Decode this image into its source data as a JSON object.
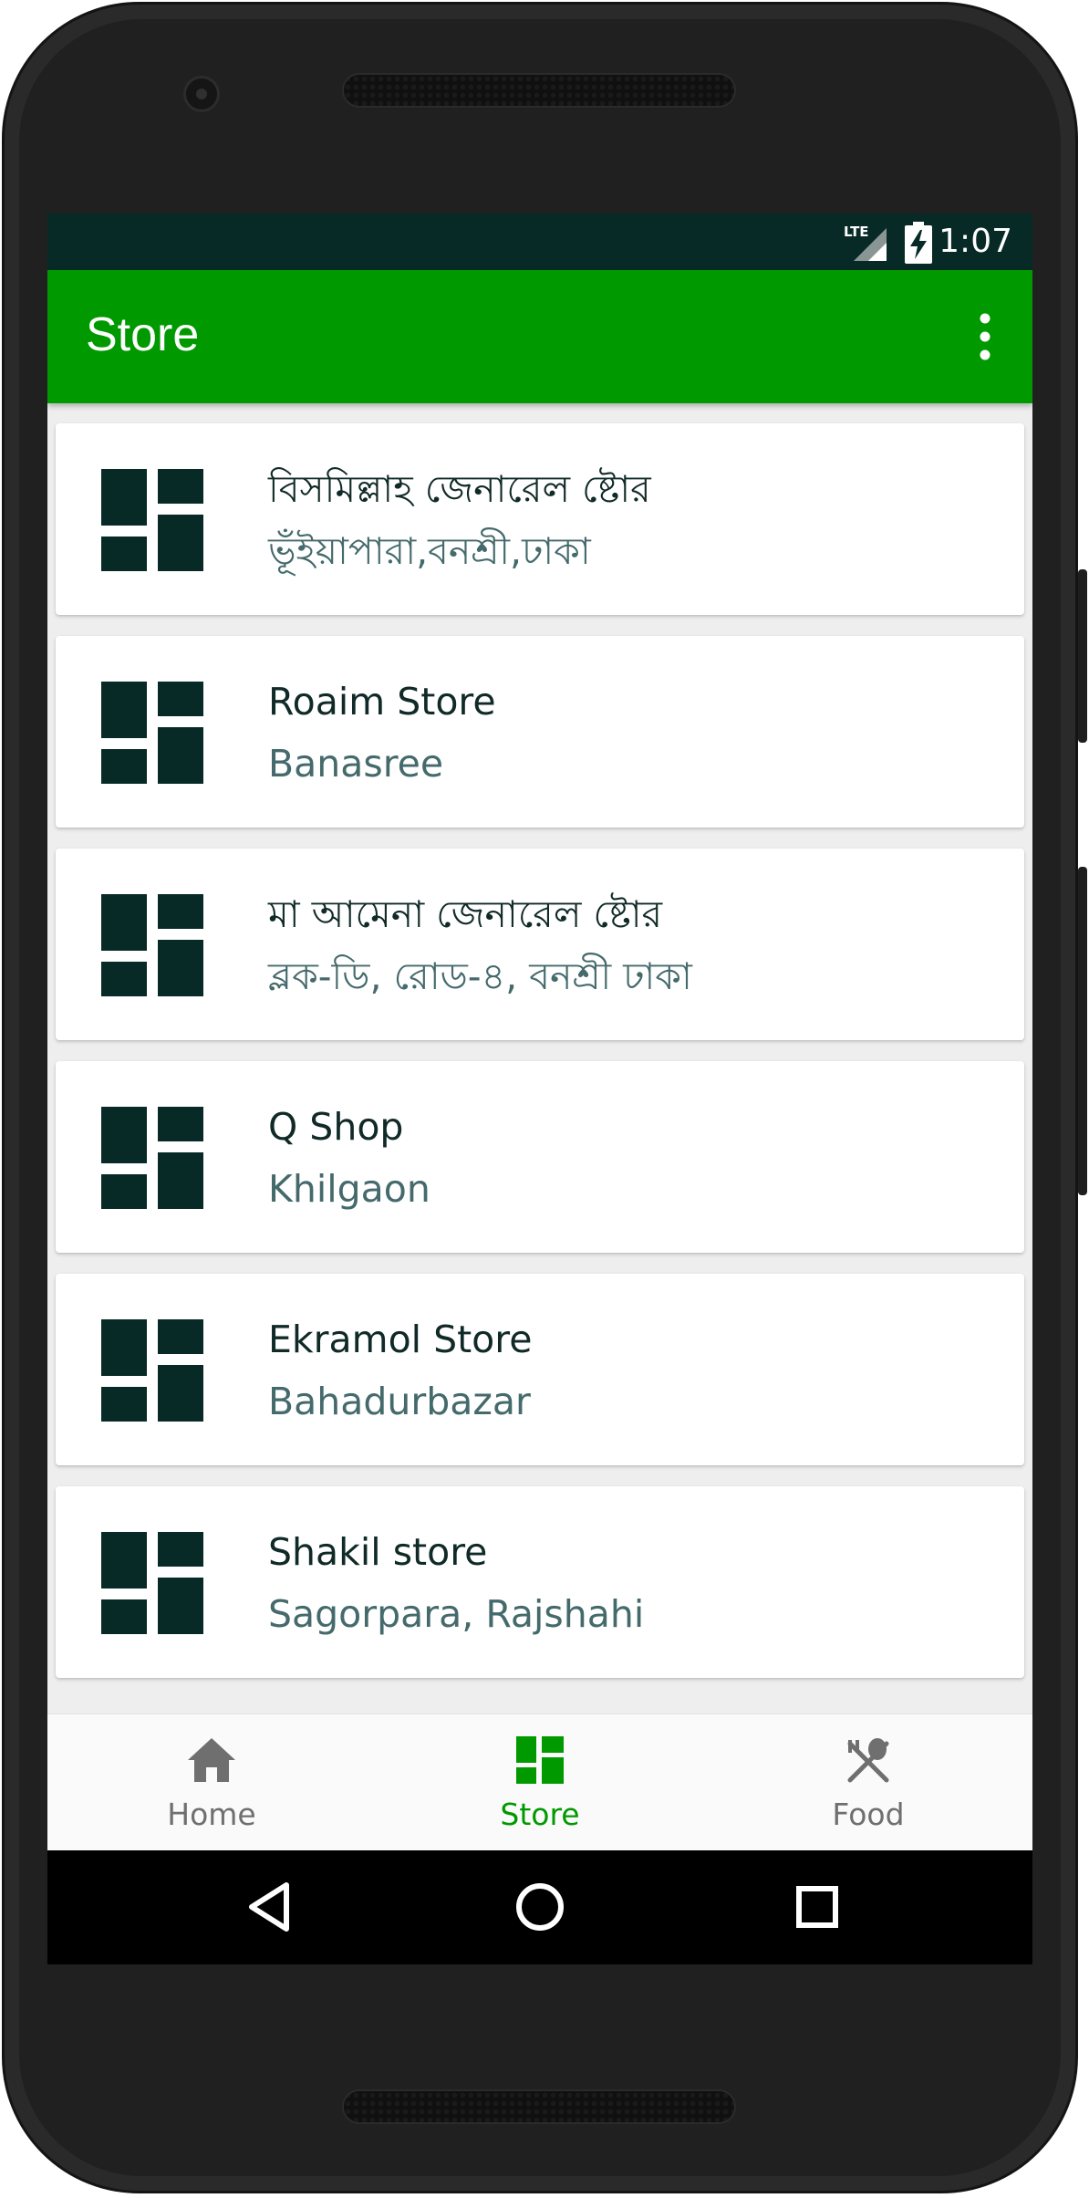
{
  "colors": {
    "status_bar": "#072a27",
    "app_bar": "#009a00",
    "card_icon": "#072a27",
    "title_text": "#102a27",
    "subtitle_text": "#456a6c",
    "nav_active": "#009a00",
    "nav_inactive": "#6f6f6f"
  },
  "status_bar": {
    "network_icon": "lte-signal-icon",
    "battery_icon": "battery-charging-icon",
    "time": "1:07"
  },
  "app_bar": {
    "title": "Store",
    "menu_icon": "more-vert-icon"
  },
  "stores": [
    {
      "name": "বিসমিল্লাহ জেনারেল ষ্টোর",
      "location": "ভূঁইয়াপারা,বনশ্রী,ঢাকা",
      "icon": "dashboard-icon"
    },
    {
      "name": "Roaim Store",
      "location": "Banasree",
      "icon": "dashboard-icon"
    },
    {
      "name": "মা আমেনা জেনারেল ষ্টোর",
      "location": "ব্লক-ডি, রোড-৪, বনশ্রী ঢাকা",
      "icon": "dashboard-icon"
    },
    {
      "name": "Q Shop",
      "location": "Khilgaon",
      "icon": "dashboard-icon"
    },
    {
      "name": "Ekramol Store",
      "location": "Bahadurbazar",
      "icon": "dashboard-icon"
    },
    {
      "name": "Shakil store",
      "location": "Sagorpara, Rajshahi",
      "icon": "dashboard-icon"
    }
  ],
  "bottom_nav": [
    {
      "label": "Home",
      "icon": "home-icon",
      "active": false
    },
    {
      "label": "Store",
      "icon": "dashboard-icon",
      "active": true
    },
    {
      "label": "Food",
      "icon": "restaurant-icon",
      "active": false
    }
  ],
  "system_nav": {
    "back_icon": "back-triangle-icon",
    "home_icon": "home-circle-icon",
    "recents_icon": "recents-square-icon"
  }
}
